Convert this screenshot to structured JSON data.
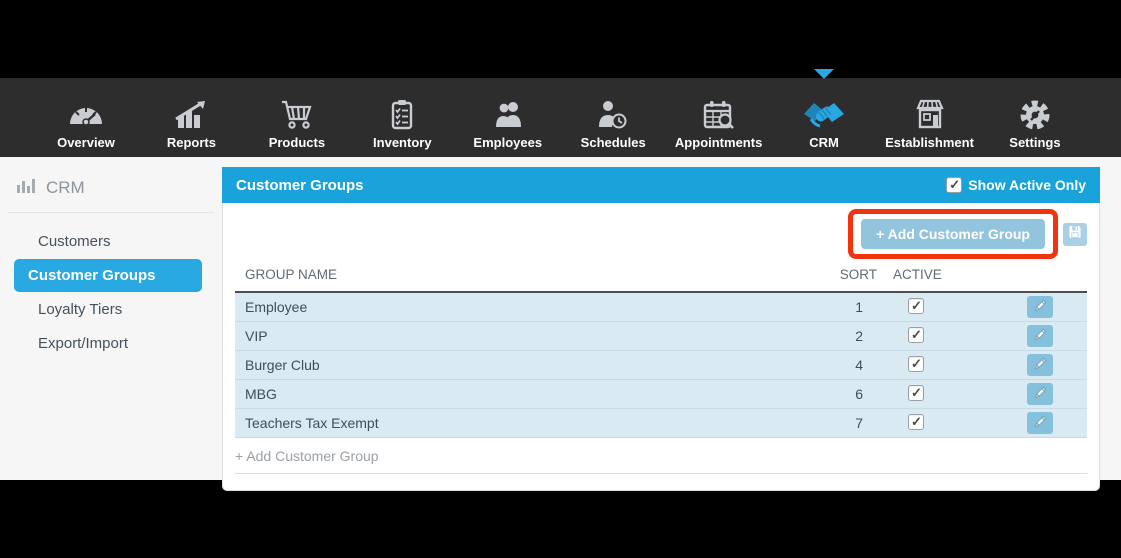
{
  "nav": {
    "items": [
      {
        "label": "Overview",
        "icon": "gauge-icon",
        "active": false
      },
      {
        "label": "Reports",
        "icon": "chart-arrow-icon",
        "active": false
      },
      {
        "label": "Products",
        "icon": "shopping-cart-icon",
        "active": false
      },
      {
        "label": "Inventory",
        "icon": "clipboard-icon",
        "active": false
      },
      {
        "label": "Employees",
        "icon": "people-icon",
        "active": false
      },
      {
        "label": "Schedules",
        "icon": "person-clock-icon",
        "active": false
      },
      {
        "label": "Appointments",
        "icon": "calendar-search-icon",
        "active": false
      },
      {
        "label": "CRM",
        "icon": "handshake-icon",
        "active": true
      },
      {
        "label": "Establishment",
        "icon": "storefront-icon",
        "active": false
      },
      {
        "label": "Settings",
        "icon": "gear-wrench-icon",
        "active": false
      }
    ]
  },
  "sidebar": {
    "title": "CRM",
    "title_icon": "bar-chart-icon",
    "items": [
      {
        "label": "Customers",
        "active": false
      },
      {
        "label": "Customer Groups",
        "active": true
      },
      {
        "label": "Loyalty Tiers",
        "active": false
      },
      {
        "label": "Export/Import",
        "active": false
      }
    ]
  },
  "panel": {
    "title": "Customer Groups",
    "show_active_only": {
      "label": "Show Active Only",
      "checked": true
    },
    "add_button_label": "+ Add Customer Group",
    "save_icon": "floppy-disk-icon",
    "table": {
      "columns": [
        "GROUP NAME",
        "SORT",
        "ACTIVE"
      ],
      "rows": [
        {
          "name": "Employee",
          "sort": "1",
          "active": true
        },
        {
          "name": "VIP",
          "sort": "2",
          "active": true
        },
        {
          "name": "Burger Club",
          "sort": "4",
          "active": true
        },
        {
          "name": "MBG",
          "sort": "6",
          "active": true
        },
        {
          "name": "Teachers Tax Exempt",
          "sort": "7",
          "active": true
        }
      ],
      "add_row_label": "+ Add Customer Group"
    }
  },
  "colors": {
    "navbar_bg": "#2d2d2e",
    "nav_icon_gray": "#c9ccd1",
    "active_blue": "#2aa7e0",
    "panel_header_blue": "#1aa3da",
    "row_blue": "#d9eaf3",
    "add_button_blue": "#92c4dd",
    "edit_button_blue": "#85c1dd",
    "annotation_red": "#f2330d"
  }
}
